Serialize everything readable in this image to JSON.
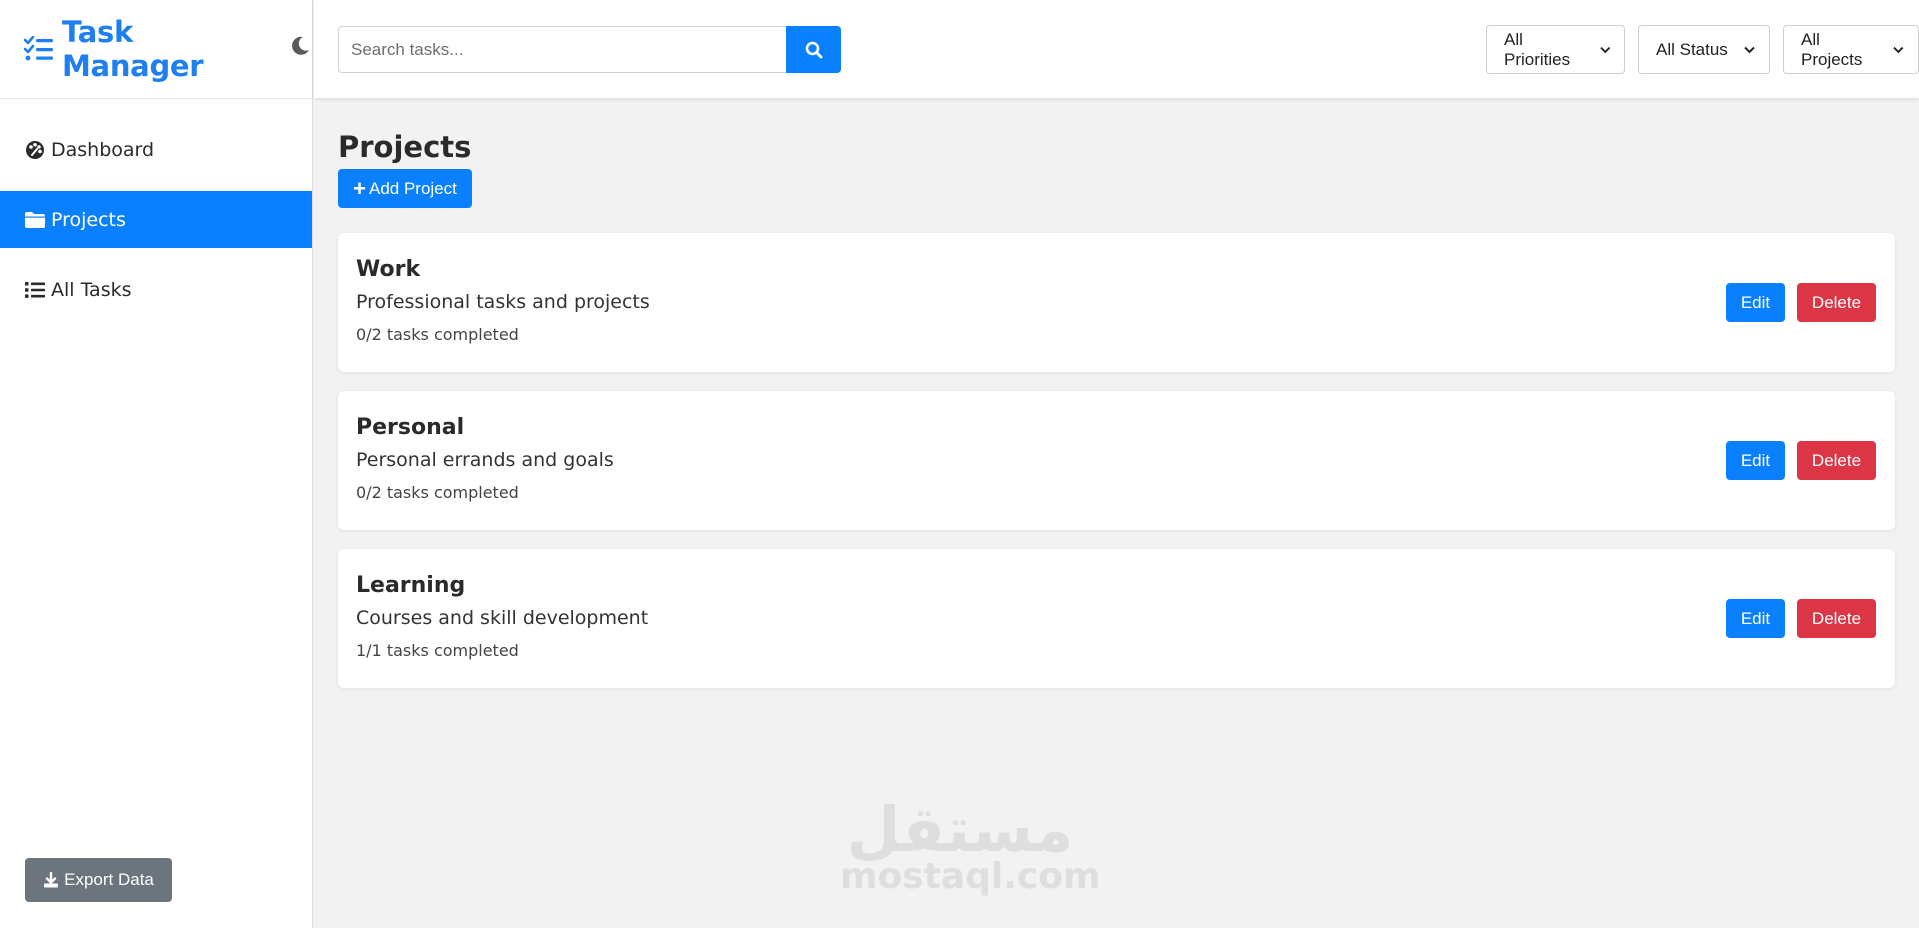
{
  "app": {
    "title": "Task Manager",
    "brand_color": "#1d7ff0",
    "icons": {
      "brand": "task-list-icon",
      "theme": "moon-icon"
    }
  },
  "sidebar": {
    "items": [
      {
        "label": "Dashboard",
        "icon": "palette-icon",
        "active": false
      },
      {
        "label": "Projects",
        "icon": "folder-icon",
        "active": true
      },
      {
        "label": "All Tasks",
        "icon": "list-icon",
        "active": false
      }
    ],
    "export_label": "Export Data"
  },
  "header": {
    "search": {
      "placeholder": "Search tasks...",
      "value": ""
    },
    "filters": [
      {
        "selected": "All Priorities"
      },
      {
        "selected": "All Status"
      },
      {
        "selected": "All Projects"
      }
    ]
  },
  "main": {
    "title": "Projects",
    "add_label": "Add Project",
    "edit_label": "Edit",
    "delete_label": "Delete",
    "projects": [
      {
        "name": "Work",
        "description": "Professional tasks and projects",
        "progress": "0/2 tasks completed"
      },
      {
        "name": "Personal",
        "description": "Personal errands and goals",
        "progress": "0/2 tasks completed"
      },
      {
        "name": "Learning",
        "description": "Courses and skill development",
        "progress": "1/1 tasks completed"
      }
    ]
  },
  "watermark": {
    "arabic": "مستقل",
    "latin": "mostaql.com"
  },
  "colors": {
    "primary": "#0b80ff",
    "danger": "#dc3545",
    "secondary": "#6c757d",
    "background": "#f2f2f2"
  }
}
